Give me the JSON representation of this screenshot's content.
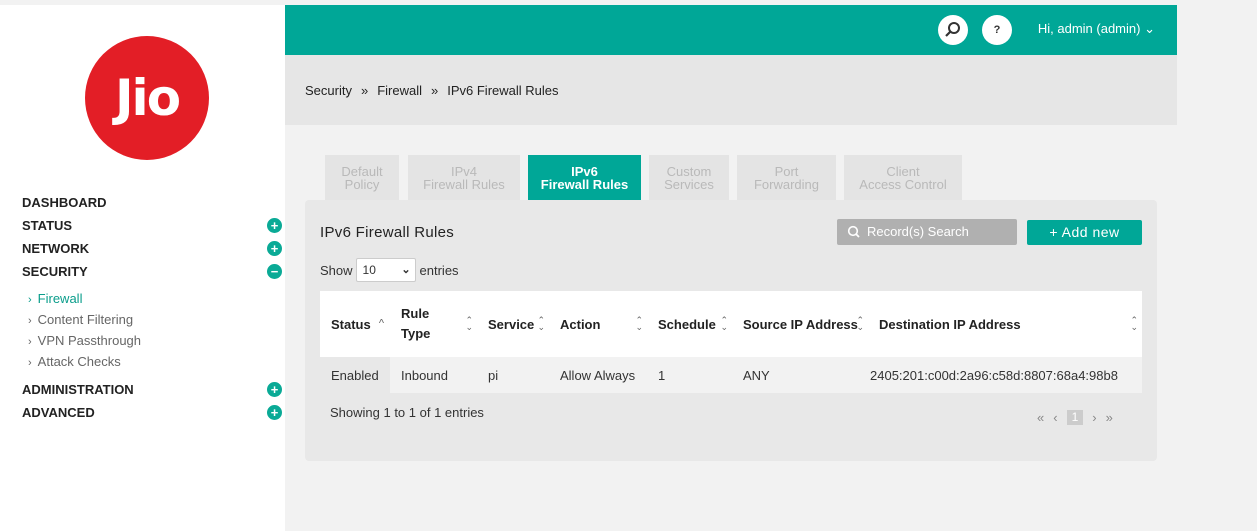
{
  "logo": {
    "text": "Jio"
  },
  "nav": {
    "items": [
      {
        "label": "DASHBOARD",
        "toggle": ""
      },
      {
        "label": "STATUS",
        "toggle": "+"
      },
      {
        "label": "NETWORK",
        "toggle": "+"
      },
      {
        "label": "SECURITY",
        "toggle": "−"
      }
    ],
    "security_sub": [
      "Firewall",
      "Content Filtering",
      "VPN Passthrough",
      "Attack Checks"
    ],
    "items_after": [
      {
        "label": "ADMINISTRATION",
        "toggle": "+"
      },
      {
        "label": "ADVANCED",
        "toggle": "+"
      }
    ]
  },
  "header": {
    "search_icon": "search-icon",
    "help_label": "?",
    "user_label": "Hi, admin (admin)",
    "chevron": "⌄"
  },
  "breadcrumb": {
    "items": [
      "Security",
      "Firewall",
      "IPv6 Firewall Rules"
    ],
    "separator": "»"
  },
  "tabs": [
    {
      "line1": "Default",
      "line2": "Policy"
    },
    {
      "line1": "IPv4",
      "line2": "Firewall Rules"
    },
    {
      "line1": "IPv6",
      "line2": "Firewall Rules"
    },
    {
      "line1": "Custom",
      "line2": "Services"
    },
    {
      "line1": "Port",
      "line2": "Forwarding"
    },
    {
      "line1": "Client",
      "line2": "Access Control"
    }
  ],
  "panel": {
    "title": "IPv6 Firewall Rules",
    "search_placeholder": "Record(s) Search",
    "add_label": "+ Add new",
    "show_label": "Show",
    "entries_value": "10",
    "entries_label": "entries"
  },
  "table": {
    "headers": [
      "Status",
      "Rule Type",
      "Service",
      "Action",
      "Schedule",
      "Source IP Address",
      "Destination IP Address"
    ],
    "rows": [
      [
        "Enabled",
        "Inbound",
        "pi",
        "Allow Always",
        "1",
        "ANY",
        "2405:201:c00d:2a96:c58d:8807:68a4:98b8"
      ]
    ]
  },
  "footer": {
    "info": "Showing 1 to 1 of 1 entries",
    "first": "«",
    "prev": "‹",
    "page": "1",
    "next": "›",
    "last": "»"
  },
  "colors": {
    "accent": "#00a797",
    "brand": "#e31e26"
  }
}
